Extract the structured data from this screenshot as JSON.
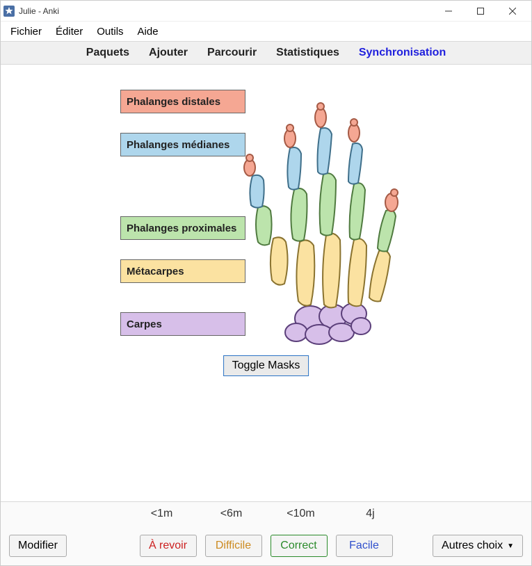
{
  "window": {
    "title": "Julie - Anki"
  },
  "menubar": {
    "file": "Fichier",
    "edit": "Éditer",
    "tools": "Outils",
    "help": "Aide"
  },
  "toolbar": {
    "decks": "Paquets",
    "add": "Ajouter",
    "browse": "Parcourir",
    "stats": "Statistiques",
    "sync": "Synchronisation"
  },
  "card": {
    "labels": {
      "distal": "Phalanges distales",
      "mediane": "Phalanges médianes",
      "proximal": "Phalanges proximales",
      "metacarpe": "Métacarpes",
      "carpe": "Carpes"
    },
    "toggle": "Toggle Masks",
    "colors": {
      "distal": "#f5a793",
      "mediane": "#aed6ec",
      "proximal": "#bce4ac",
      "metacarpe": "#fbe2a1",
      "carpe": "#d7bfe9"
    }
  },
  "review": {
    "intervals": {
      "again": "<1m",
      "hard": "<6m",
      "good": "<10m",
      "easy": "4j"
    },
    "buttons": {
      "edit": "Modifier",
      "again": "À revoir",
      "hard": "Difficile",
      "good": "Correct",
      "easy": "Facile",
      "more": "Autres choix"
    }
  }
}
